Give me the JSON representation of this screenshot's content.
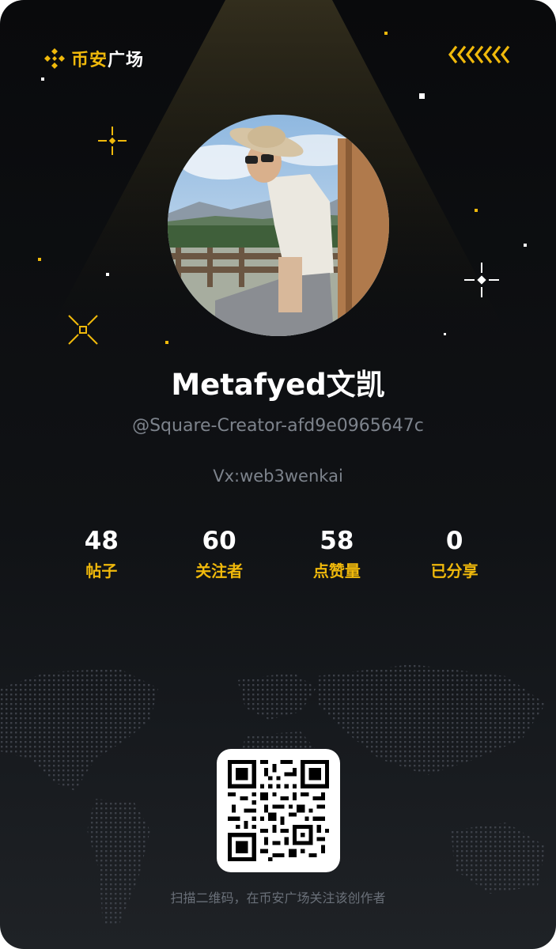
{
  "brand": {
    "name_accent": "币安",
    "name_rest": "广场",
    "logo_icon": "binance-diamond-icon",
    "accent_color": "#f0b90b"
  },
  "decor": {
    "chevrons_icon": "chevron-left-row-icon"
  },
  "profile": {
    "avatar_icon": "user-avatar-photo",
    "display_name": "Metafyed文凯",
    "handle": "@Square-Creator-afd9e0965647c",
    "bio": "Vx:web3wenkai"
  },
  "stats": [
    {
      "value": "48",
      "label": "帖子"
    },
    {
      "value": "60",
      "label": "关注者"
    },
    {
      "value": "58",
      "label": "点赞量"
    },
    {
      "value": "0",
      "label": "已分享"
    }
  ],
  "qr": {
    "icon": "qr-code-icon"
  },
  "footer": {
    "text": "扫描二维码，在币安广场关注该创作者"
  }
}
